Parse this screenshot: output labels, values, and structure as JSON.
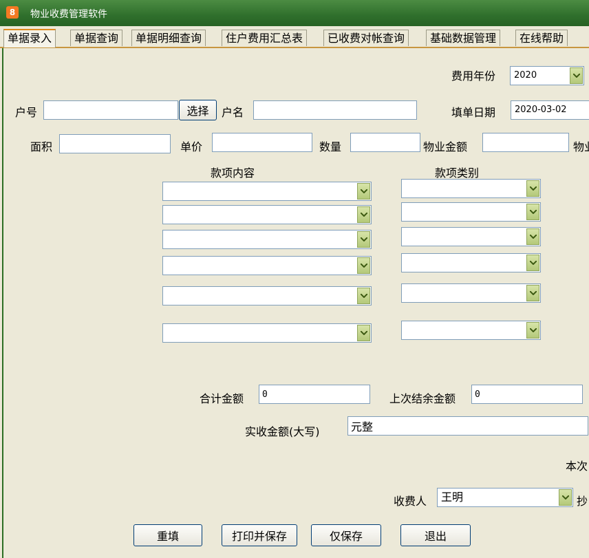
{
  "window": {
    "title": "物业收费管理软件",
    "icon_glyph": "8"
  },
  "tabs": [
    "单据录入",
    "单据查询",
    "单据明细查询",
    "住户费用汇总表",
    "已收费对帐查询",
    "基础数据管理",
    "在线帮助"
  ],
  "form": {
    "fee_year_label": "费用年份",
    "fee_year_value": "2020",
    "household_no_label": "户号",
    "household_no_value": "",
    "select_button": "选择",
    "household_name_label": "户名",
    "household_name_value": "",
    "fill_date_label": "填单日期",
    "fill_date_value": "2020-03-02",
    "area_label": "面积",
    "area_value": "",
    "unit_price_label": "单价",
    "unit_price_value": "",
    "quantity_label": "数量",
    "quantity_value": "",
    "property_amount_label": "物业金额",
    "property_amount_value": "",
    "property_cut_label": "物业",
    "item_content_header": "款项内容",
    "item_category_header": "款项类别",
    "item_contents": [
      "",
      "",
      "",
      "",
      "",
      ""
    ],
    "item_categories": [
      "",
      "",
      "",
      "",
      "",
      ""
    ],
    "total_amount_label": "合计金额",
    "total_amount_value": "0",
    "last_balance_label": "上次结余金额",
    "last_balance_value": "0",
    "actual_amount_label": "实收金额(大写)",
    "actual_amount_value": "元整",
    "this_time_label": "本次",
    "collector_label": "收费人",
    "collector_value": "王明",
    "copy_cut_label": "抄"
  },
  "buttons": {
    "reset": "重填",
    "print_save": "打印并保存",
    "save_only": "仅保存",
    "exit": "退出"
  }
}
